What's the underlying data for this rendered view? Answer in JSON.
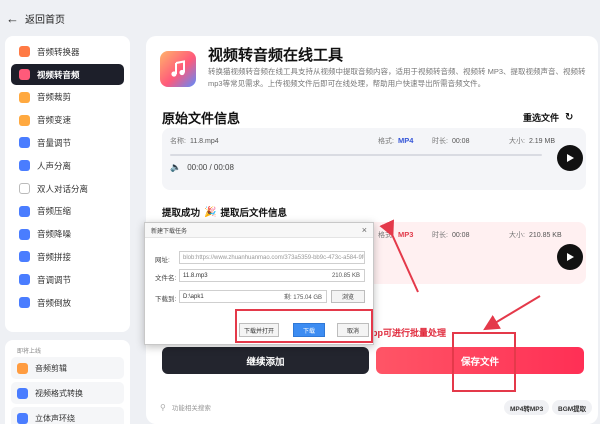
{
  "topbar": {
    "back_icon": "arrow-left-icon",
    "title": "返回首页"
  },
  "sidebar": {
    "items": [
      {
        "label": "音频转换器",
        "icon": "audio-converter-icon",
        "color": "#ff7a45",
        "active": false
      },
      {
        "label": "视频转音频",
        "icon": "video-to-audio-icon",
        "color": "#ff5a7a",
        "active": true
      },
      {
        "label": "音频裁剪",
        "icon": "audio-cut-icon",
        "color": "#ffa940",
        "active": false
      },
      {
        "label": "音频变速",
        "icon": "audio-speed-icon",
        "color": "#ffa940",
        "active": false
      },
      {
        "label": "音量调节",
        "icon": "volume-icon",
        "color": "#4a7dff",
        "active": false
      },
      {
        "label": "人声分离",
        "icon": "vocal-separate-icon",
        "color": "#4a7dff",
        "active": false
      },
      {
        "label": "双人对话分离",
        "icon": "dialog-separate-icon",
        "color": "#ffffff",
        "active": false
      },
      {
        "label": "音频压缩",
        "icon": "audio-compress-icon",
        "color": "#4a7dff",
        "active": false
      },
      {
        "label": "音频降噪",
        "icon": "denoise-icon",
        "color": "#4a7dff",
        "active": false
      },
      {
        "label": "音频拼接",
        "icon": "audio-merge-icon",
        "color": "#4a7dff",
        "active": false
      },
      {
        "label": "音调调节",
        "icon": "pitch-icon",
        "color": "#4a7dff",
        "active": false
      },
      {
        "label": "音频倒放",
        "icon": "reverse-icon",
        "color": "#4a7dff",
        "active": false
      }
    ],
    "soon_label": "即将上线",
    "soon_items": [
      {
        "label": "音频剪辑",
        "icon": "audio-edit-icon",
        "color": "#ff9c40"
      },
      {
        "label": "视频格式转换",
        "icon": "video-format-icon",
        "color": "#4a7dff"
      },
      {
        "label": "立体声环绕",
        "icon": "surround-icon",
        "color": "#4a7dff"
      }
    ]
  },
  "main": {
    "title": "视频转音频在线工具",
    "description": "转换猫视频转音频在线工具支持从视频中提取音频内容，适用于视频转音频、视频转 MP3、提取视频声音、视频转mp3等常见需求。上传视频文件后即可在线处理，帮助用户快速导出所需音频文件。",
    "original_section_title": "原始文件信息",
    "reselect_label": "重选文件",
    "original": {
      "name_label": "名称:",
      "name": "11.8.mp4",
      "format_label": "格式:",
      "format": "MP4",
      "duration_label": "时长:",
      "duration": "00:08",
      "size_label": "大小:",
      "size": "2.19 MB",
      "time": "00:00 / 00:08"
    },
    "extract_status": "提取成功",
    "extract_title": "提取后文件信息",
    "extracted": {
      "format_label": "格式:",
      "format": "MP3",
      "duration_label": "时长:",
      "duration": "00:08",
      "size_label": "大小:",
      "size": "210.85 KB"
    },
    "batch_hint": "pp可进行批量处理",
    "continue_label": "继续添加",
    "save_label": "保存文件",
    "search_placeholder": "功能相关搜索",
    "tags": [
      "MP4转MP3",
      "BGM提取"
    ],
    "accent_color": "#ff3b55"
  },
  "dialog": {
    "title": "新建下载任务",
    "url_label": "网址:",
    "url_value": "blob:https://www.zhuanhuanmao.com/373a5359-bb9c-473c-a584-9f0",
    "filename_label": "文件名:",
    "filename_value": "11.8.mp3",
    "filename_size": "210.85 KB",
    "save_to_label": "下载到:",
    "save_to_value": "D:\\apk1",
    "free_space": "剩: 175.04 GB",
    "browse_label": "浏览",
    "open_after_label": "下载并打开",
    "download_label": "下载",
    "cancel_label": "取消"
  }
}
